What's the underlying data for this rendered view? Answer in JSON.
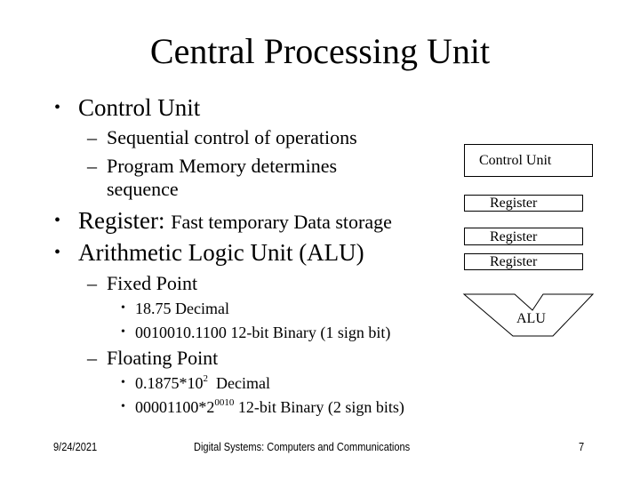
{
  "slide": {
    "title": "Central Processing Unit"
  },
  "content": {
    "control_unit": {
      "bullet": "•",
      "label": "Control Unit",
      "sub": [
        {
          "dash": "–",
          "text": "Sequential control of operations"
        },
        {
          "dash": "–",
          "text": "Program Memory determines",
          "continuation": "sequence"
        }
      ]
    },
    "register": {
      "bullet": "•",
      "label": "Register: ",
      "description": "Fast temporary Data storage"
    },
    "alu": {
      "bullet": "•",
      "label": "Arithmetic Logic Unit (ALU)",
      "fixed_point": {
        "dash": "–",
        "label": "Fixed Point",
        "items": [
          {
            "bullet": "•",
            "text": "18.75 Decimal"
          },
          {
            "bullet": "•",
            "text": "0010010.1100 12-bit Binary (1 sign bit)"
          }
        ]
      },
      "floating_point": {
        "dash": "–",
        "label": "Floating Point",
        "items": [
          {
            "bullet": "•",
            "base": "0.1875*10",
            "exponent": "2",
            "suffix": "  Decimal"
          },
          {
            "bullet": "•",
            "base": "00001100*2",
            "exponent": "0010",
            "suffix": " 12-bit Binary (2 sign bits)"
          }
        ]
      }
    }
  },
  "diagram": {
    "control_unit_label": "Control Unit",
    "registers": [
      "Register",
      "Register",
      "Register"
    ],
    "alu_label": "ALU"
  },
  "footer": {
    "date": "9/24/2021",
    "course": "Digital Systems: Computers and Communications",
    "page_number": "7"
  }
}
